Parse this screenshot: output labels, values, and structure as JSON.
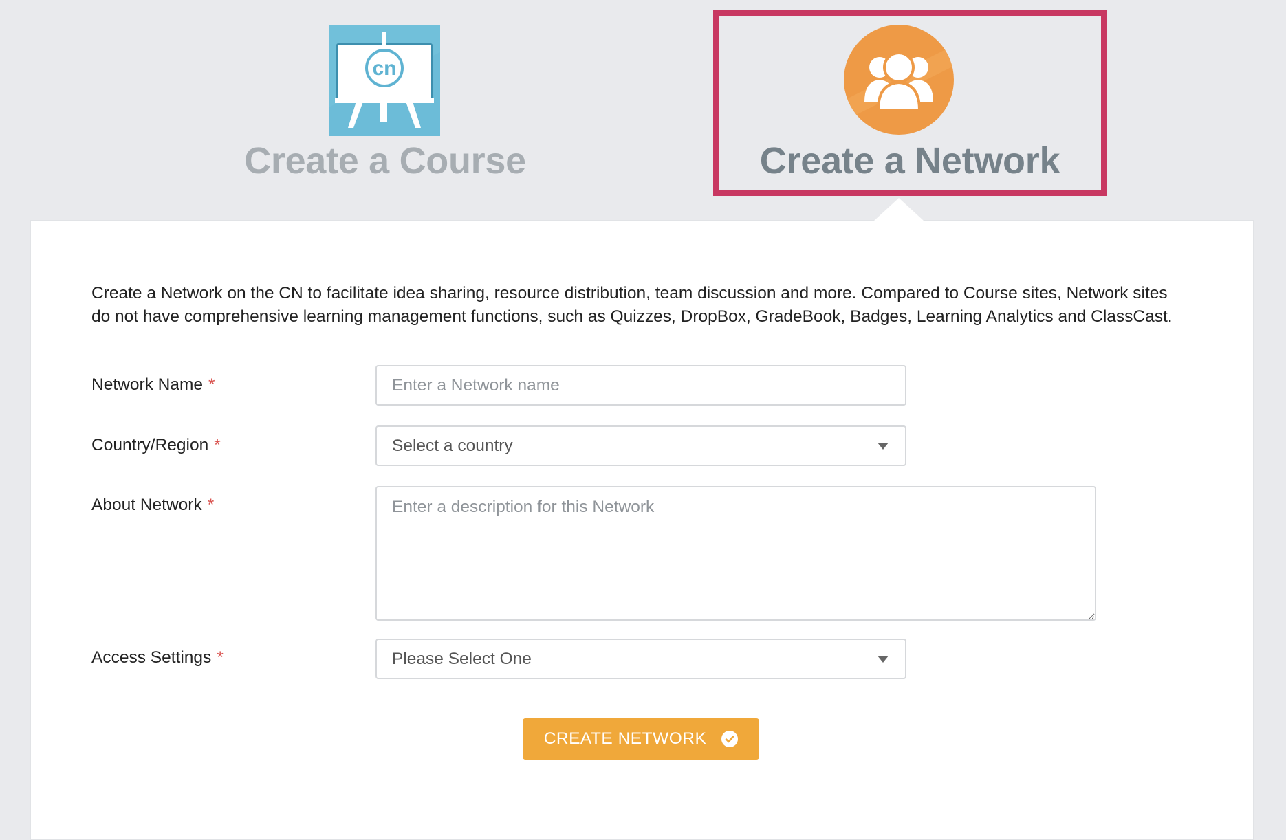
{
  "options": {
    "course": {
      "title": "Create a Course",
      "icon": "easel-cn-icon"
    },
    "network": {
      "title": "Create a Network",
      "icon": "group-users-icon",
      "selected": true
    }
  },
  "colors": {
    "highlight": "#c83862",
    "course_icon_bg": "#6cbcd8",
    "network_icon_bg": "#ee9a46",
    "button": "#f0a83a",
    "required": "#d9534f"
  },
  "form": {
    "intro": "Create a Network on the CN to facilitate idea sharing, resource distribution, team discussion and more. Compared to Course sites, Network sites do not have comprehensive learning management functions, such as Quizzes, DropBox, GradeBook, Badges, Learning Analytics and ClassCast.",
    "required_marker": "*",
    "network_name": {
      "label": "Network Name",
      "placeholder": "Enter a Network name",
      "value": ""
    },
    "country": {
      "label": "Country/Region",
      "selected": "Select a country"
    },
    "about": {
      "label": "About Network",
      "placeholder": "Enter a description for this Network",
      "value": ""
    },
    "access": {
      "label": "Access Settings",
      "selected": "Please Select One"
    },
    "submit_label": "CREATE NETWORK"
  }
}
